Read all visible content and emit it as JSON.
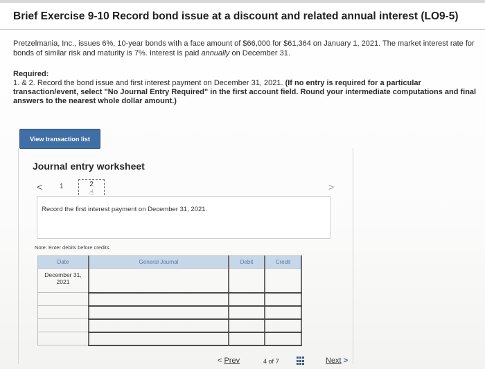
{
  "exercise": {
    "title": "Brief Exercise 9-10 Record bond issue at a discount and related annual interest (LO9-5)",
    "description_a": "Pretzelmania, Inc., issues 6%, 10-year bonds with a face amount of $66,000 for $61,364 on January 1, 2021. The market interest rate for bonds of similar risk and maturity is 7%. Interest is paid ",
    "description_em": "annually",
    "description_b": " on December 31.",
    "required_head": "Required:",
    "required_plain": "1. & 2. Record the bond issue and first interest payment on December 31, 2021. ",
    "required_bold": "(If no entry is required for a particular transaction/event, select \"No Journal Entry Required\" in the first account field. Round your intermediate computations and final answers to the nearest whole dollar amount.)"
  },
  "buttons": {
    "view_transaction_list": "View transaction list"
  },
  "worksheet": {
    "title": "Journal entry worksheet",
    "nav_left": "<",
    "nav_right": ">",
    "pages": [
      "1",
      "2"
    ],
    "instruction": "Record the first interest payment on December 31, 2021.",
    "note": "Note: Enter debits before credits."
  },
  "table": {
    "headers": {
      "date": "Date",
      "journal": "General Journal",
      "debit": "Debit",
      "credit": "Credit"
    },
    "date_line1": "December 31,",
    "date_line2": "2021"
  },
  "footer": {
    "prev_arrow": "<",
    "prev": "Prev",
    "page_current": "4",
    "page_of": "of",
    "page_total": "7",
    "next": "Next",
    "next_arrow": ">"
  },
  "icons": {
    "hand_cursor": "pointer-hand-icon",
    "grid": "grid-icon"
  },
  "colors": {
    "button_blue": "#3f6fa5",
    "header_blue": "#c6d7ea"
  }
}
